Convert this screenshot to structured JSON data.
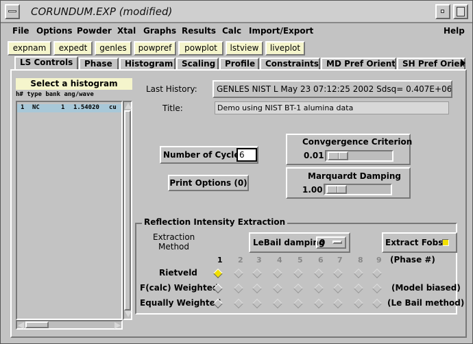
{
  "window": {
    "title": "CORUNDUM.EXP (modified)"
  },
  "menu": [
    "File",
    "Options",
    "Powder",
    "Xtal",
    "Graphs",
    "Results",
    "Calc",
    "Import/Export",
    "Help"
  ],
  "toolbar": [
    "expnam",
    "expedt",
    "genles",
    "powpref",
    "powplot",
    "lstview",
    "liveplot"
  ],
  "tabs": [
    "LS Controls",
    "Phase",
    "Histogram",
    "Scaling",
    "Profile",
    "Constraints",
    "MD Pref Orient",
    "SH Pref Orient"
  ],
  "histogram": {
    "header": "Select a histogram",
    "columns": "h# type bank ang/wave",
    "row": {
      "num": "1",
      "type": "NC",
      "bank": "1",
      "wave": "1.54020",
      "unit": "cu"
    }
  },
  "last_history": {
    "label": "Last History:",
    "value": "GENLES  NIST L May 23 07:12:25 2002 Sdsq= 0.407E+06"
  },
  "title_field": {
    "label": "Title:",
    "value": "Demo using NIST BT-1 alumina data"
  },
  "cycles": {
    "label": "Number of Cycles",
    "value": "6"
  },
  "print_options": "Print Options (0)",
  "convergence": {
    "label": "Convgergence Criterion",
    "value": "0.01"
  },
  "marquardt": {
    "label": "Marquardt Damping",
    "value": "1.00"
  },
  "rie": {
    "group_label": "Reflection Intensity Extraction",
    "method_label_1": "Extraction",
    "method_label_2": "Method",
    "lebail_label": "LeBail damping",
    "lebail_value": "0",
    "extract_label": "Extract Fobs",
    "phase_numbers": [
      "1",
      "2",
      "3",
      "4",
      "5",
      "6",
      "7",
      "8",
      "9"
    ],
    "phase_note": "(Phase #)",
    "rows": [
      {
        "label": "Rietveld",
        "note": ""
      },
      {
        "label": "F(calc) Weighted",
        "note": "(Model biased)"
      },
      {
        "label": "Equally Weighted",
        "note": "(Le Bail method)"
      }
    ]
  },
  "colors": {
    "highlight": "#a8c8d8",
    "toolbar_btn": "#f5f5cc",
    "radio_on": "#f2e000",
    "checkbox_on": "#f2e000"
  }
}
